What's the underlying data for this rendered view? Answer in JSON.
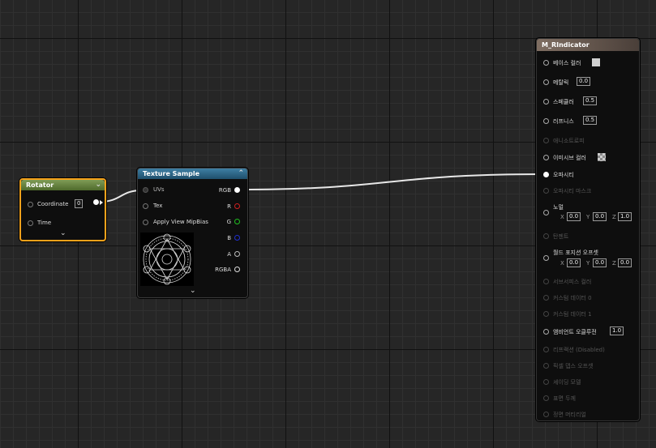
{
  "rotator": {
    "title": "Rotator",
    "coordinate_label": "Coordinate",
    "coordinate_value": "0",
    "time_label": "Time"
  },
  "texture_sample": {
    "title": "Texture Sample",
    "inputs": [
      "UVs",
      "Tex",
      "Apply View MipBias"
    ],
    "outputs": [
      "RGB",
      "R",
      "G",
      "B",
      "A",
      "RGBA"
    ]
  },
  "material": {
    "title": "M_RIndicator",
    "base_color": "베이스 컬러",
    "metallic": "메탈릭",
    "metallic_value": "0.0",
    "specular": "스페큘러",
    "specular_value": "0.5",
    "roughness": "러프니스",
    "roughness_value": "0.5",
    "anisotropy": "애니소트로피",
    "emissive": "이미시브 컬러",
    "opacity": "오파시티",
    "opacity_mask": "오파시티 마스크",
    "normal": "노멀",
    "normal_x": "0.0",
    "normal_y": "0.0",
    "normal_z": "1.0",
    "tangent": "탄젠트",
    "wpo": "월드 포지션 오프셋",
    "wpo_x": "0.0",
    "wpo_y": "0.0",
    "wpo_z": "0.0",
    "subsurface": "서브서피스 컬러",
    "custom0": "커스텀 데이터 0",
    "custom1": "커스텀 데이터 1",
    "ao": "앰비언트 오클루전",
    "ao_value": "1.0",
    "refraction": "리프랙션 (Disabled)",
    "pdo": "픽셀 뎁스 오프셋",
    "shading": "셰이딩 모델",
    "thickness": "표면 두께",
    "front_material": "정면 머티리얼",
    "axis_x": "X",
    "axis_y": "Y",
    "axis_z": "Z"
  },
  "colors": {
    "rotator_header": "#6a8a3c",
    "rotator_border": "#f5a21b",
    "texture_header": "#2f6a8a",
    "material_header": "#6e5f55",
    "pin_r": "#d02020",
    "pin_g": "#20c020",
    "pin_b": "#2030d0"
  }
}
